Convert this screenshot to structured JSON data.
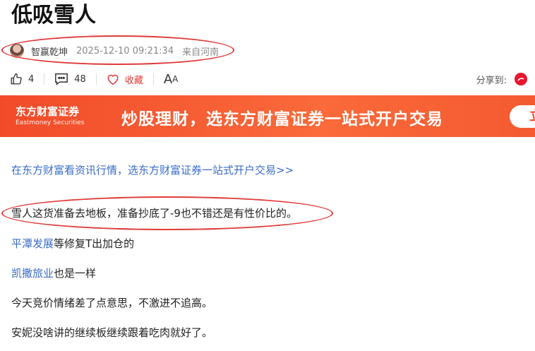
{
  "article": {
    "title": "低吸雪人",
    "author": "智赢乾坤",
    "date": "2025-12-10 09:21:34",
    "location": "来自河南"
  },
  "actions": {
    "likes": "4",
    "comments": "48",
    "favorite_label": "收藏",
    "font_label_big": "A",
    "font_label_small": "A",
    "share_label": "分享到:"
  },
  "banner": {
    "logo_cn": "东方财富证券",
    "logo_en": "Eastmoney Securities",
    "slogan": "炒股理财，选东方财富证券一站式开户交易",
    "button_label": "立"
  },
  "body": {
    "promo_link": "在东方财富看资讯行情，选东方财富证券一站式开户交易>>",
    "p1": "雪人这货准备去地板，准备抄底了-9也不错还是有性价比的。",
    "p2_link": "平潭发展",
    "p2_rest": "等修复T出加仓的",
    "p3_link": "凯撒旅业",
    "p3_rest": "也是一样",
    "p4": "今天竞价情绪差了点意思，不激进不追高。",
    "p5": "安妮没啥讲的继续板继续跟着吃肉就好了。"
  },
  "colors": {
    "annotation_red": "#e03a3a",
    "banner_orange": "#f24b2a",
    "link_blue": "#3a6cc5"
  }
}
